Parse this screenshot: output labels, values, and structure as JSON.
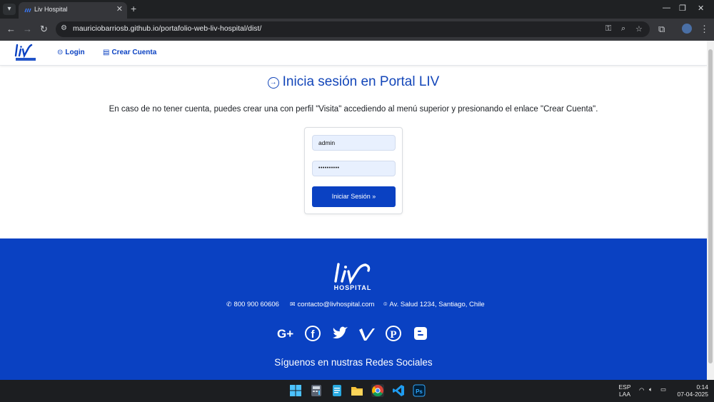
{
  "browser": {
    "tab_title": "Liv Hospital",
    "tab_close": "✕",
    "new_tab": "+",
    "url": "mauriciobarriosb.github.io/portafolio-web-liv-hospital/dist/"
  },
  "navbar": {
    "login_label": "Login",
    "create_label": "Crear Cuenta"
  },
  "main": {
    "heading": "Inicia sesión en Portal LIV",
    "info": "En caso de no tener cuenta, puedes crear una con perfil \"Visita\" accediendo al menú superior y presionando el enlace \"Crear Cuenta\".",
    "username_value": "admin",
    "password_value": "••••••••••",
    "submit_label": "Iniciar Sesión »"
  },
  "footer": {
    "phone": "800 900 60606",
    "email": "contacto@livhospital.com",
    "address": "Av. Salud 1234, Santiago, Chile",
    "social_icons": [
      "google-plus-icon",
      "facebook-icon",
      "twitter-icon",
      "vimeo-icon",
      "pinterest-icon",
      "blogger-icon"
    ],
    "follow_text": "Síguenos en nustras Redes Sociales"
  },
  "taskbar": {
    "lang_top": "ESP",
    "lang_bottom": "LAA",
    "time": "0:14",
    "date": "07-04-2025"
  },
  "colors": {
    "brand_blue": "#0a41c2",
    "heading_blue": "#1346b9"
  }
}
